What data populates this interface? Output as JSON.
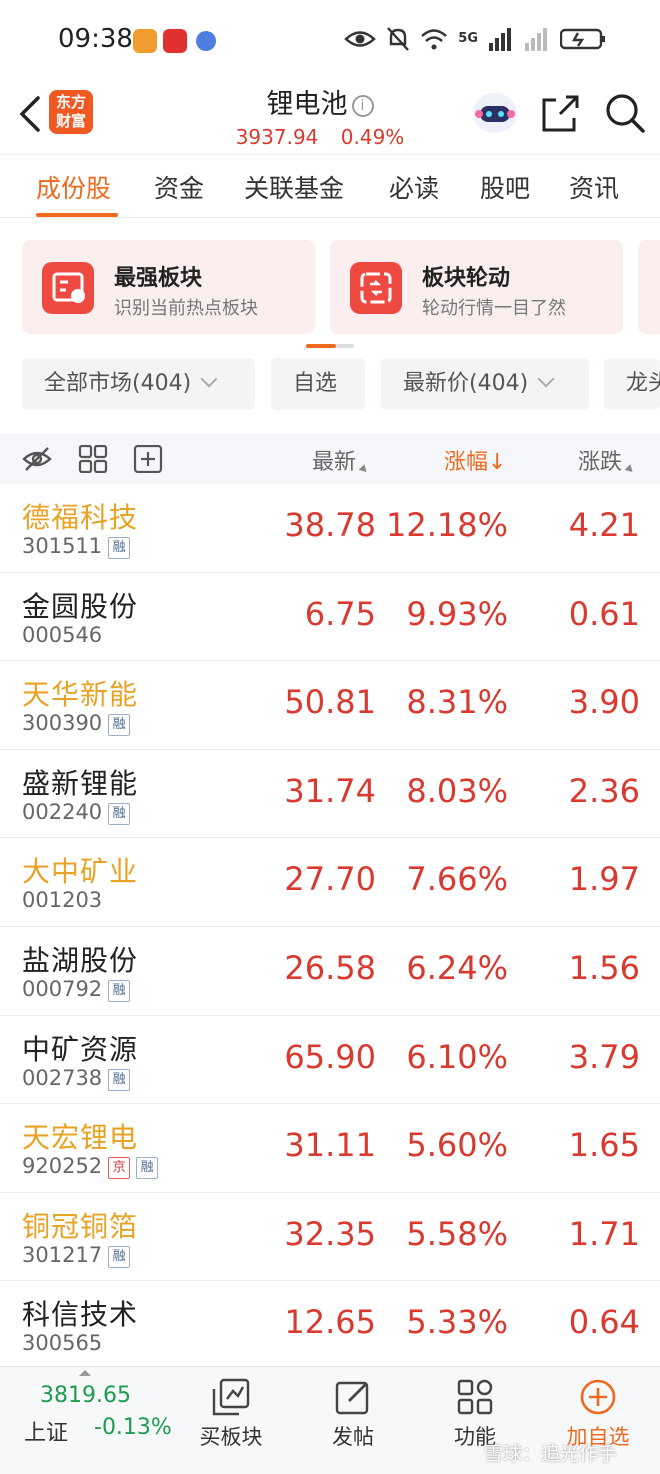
{
  "status_bar": {
    "time": "09:38",
    "network": "5G"
  },
  "header": {
    "logo_text": "东方财富",
    "title": "锂电池",
    "index_value": "3937.94",
    "index_change": "0.49%"
  },
  "tabs": [
    {
      "label": "成份股",
      "active": true
    },
    {
      "label": "资金"
    },
    {
      "label": "关联基金"
    },
    {
      "label": "必读"
    },
    {
      "label": "股吧"
    },
    {
      "label": "资讯"
    }
  ],
  "cards": [
    {
      "title": "最强板块",
      "subtitle": "识别当前热点板块",
      "icon": "ranking-icon"
    },
    {
      "title": "板块轮动",
      "subtitle": "轮动行情一目了然",
      "icon": "rotation-icon"
    }
  ],
  "filters": [
    {
      "label": "全部市场(404)",
      "dropdown": true
    },
    {
      "label": "自选",
      "dropdown": false
    },
    {
      "label": "最新价(404)",
      "dropdown": true
    },
    {
      "label": "龙头",
      "dropdown": false
    }
  ],
  "columns": {
    "latest": "最新",
    "change_pct": "涨幅",
    "change_pct_sort": "↓",
    "change": "涨跌"
  },
  "stocks": [
    {
      "name": "德福科技",
      "code": "301511",
      "tags": [
        "融"
      ],
      "highlight": true,
      "price": "38.78",
      "pct": "12.18%",
      "chg": "4.21"
    },
    {
      "name": "金圆股份",
      "code": "000546",
      "tags": [],
      "highlight": false,
      "price": "6.75",
      "pct": "9.93%",
      "chg": "0.61"
    },
    {
      "name": "天华新能",
      "code": "300390",
      "tags": [
        "融"
      ],
      "highlight": true,
      "price": "50.81",
      "pct": "8.31%",
      "chg": "3.90"
    },
    {
      "name": "盛新锂能",
      "code": "002240",
      "tags": [
        "融"
      ],
      "highlight": false,
      "price": "31.74",
      "pct": "8.03%",
      "chg": "2.36"
    },
    {
      "name": "大中矿业",
      "code": "001203",
      "tags": [],
      "highlight": true,
      "price": "27.70",
      "pct": "7.66%",
      "chg": "1.97"
    },
    {
      "name": "盐湖股份",
      "code": "000792",
      "tags": [
        "融"
      ],
      "highlight": false,
      "price": "26.58",
      "pct": "6.24%",
      "chg": "1.56"
    },
    {
      "name": "中矿资源",
      "code": "002738",
      "tags": [
        "融"
      ],
      "highlight": false,
      "price": "65.90",
      "pct": "6.10%",
      "chg": "3.79"
    },
    {
      "name": "天宏锂电",
      "code": "920252",
      "tags": [
        "京",
        "融"
      ],
      "highlight": true,
      "price": "31.11",
      "pct": "5.60%",
      "chg": "1.65"
    },
    {
      "name": "铜冠铜箔",
      "code": "301217",
      "tags": [
        "融"
      ],
      "highlight": true,
      "price": "32.35",
      "pct": "5.58%",
      "chg": "1.71"
    },
    {
      "name": "科信技术",
      "code": "300565",
      "tags": [],
      "highlight": false,
      "price": "12.65",
      "pct": "5.33%",
      "chg": "0.64"
    }
  ],
  "bottom_bar": {
    "index_value": "3819.65",
    "index_name": "上证",
    "index_change": "-0.13%",
    "items": [
      {
        "label": "买板块",
        "icon": "buy-sector-icon"
      },
      {
        "label": "发帖",
        "icon": "post-icon"
      },
      {
        "label": "功能",
        "icon": "grid-icon"
      },
      {
        "label": "加自选",
        "icon": "add-watchlist-icon"
      }
    ],
    "watermark": "雪球：追光作手"
  },
  "colors": {
    "accent": "#ee6a1e",
    "up": "#d9392f",
    "down": "#1d9b4e",
    "highlight_name": "#e8a325"
  }
}
